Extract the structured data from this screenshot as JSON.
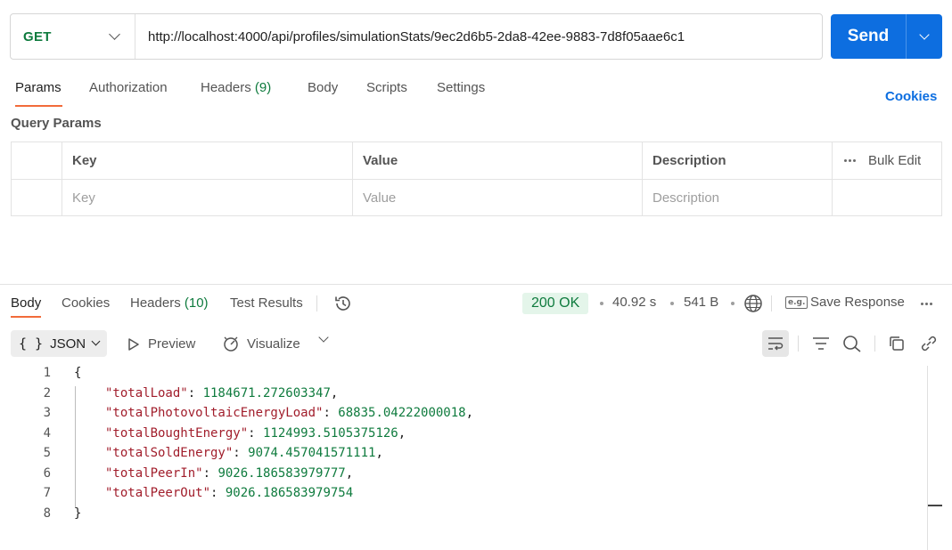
{
  "request": {
    "method": "GET",
    "url": "http://localhost:4000/api/profiles/simulationStats/9ec2d6b5-2da8-42ee-9883-7d8f05aae6c1",
    "send_label": "Send"
  },
  "request_tabs": {
    "params": "Params",
    "authorization": "Authorization",
    "headers": "Headers",
    "headers_count": "(9)",
    "body": "Body",
    "scripts": "Scripts",
    "settings": "Settings",
    "cookies": "Cookies"
  },
  "query_params": {
    "title": "Query Params",
    "columns": [
      "Key",
      "Value",
      "Description"
    ],
    "bulk_edit": "Bulk Edit",
    "placeholders": {
      "key": "Key",
      "value": "Value",
      "description": "Description"
    }
  },
  "response_tabs": {
    "body": "Body",
    "cookies": "Cookies",
    "headers": "Headers",
    "headers_count": "(10)",
    "test_results": "Test Results"
  },
  "response_meta": {
    "status": "200 OK",
    "time": "40.92 s",
    "size": "541 B",
    "example_badge": "e.g.",
    "save_response": "Save Response",
    "status_color": "#0f7b3e"
  },
  "response_toolbar": {
    "format_brace": "{ }",
    "format": "JSON",
    "preview": "Preview",
    "visualize": "Visualize"
  },
  "response_body": {
    "lines": [
      {
        "n": "1",
        "open": "{"
      },
      {
        "n": "2",
        "key": "\"totalLoad\"",
        "value": "1184671.272603347",
        "comma": ","
      },
      {
        "n": "3",
        "key": "\"totalPhotovoltaicEnergyLoad\"",
        "value": "68835.04222000018",
        "comma": ","
      },
      {
        "n": "4",
        "key": "\"totalBoughtEnergy\"",
        "value": "1124993.5105375126",
        "comma": ","
      },
      {
        "n": "5",
        "key": "\"totalSoldEnergy\"",
        "value": "9074.457041571111",
        "comma": ","
      },
      {
        "n": "6",
        "key": "\"totalPeerIn\"",
        "value": "9026.186583979777",
        "comma": ","
      },
      {
        "n": "7",
        "key": "\"totalPeerOut\"",
        "value": "9026.186583979754",
        "comma": ""
      },
      {
        "n": "8",
        "open": "}"
      }
    ]
  },
  "colors": {
    "accent": "#0d6ee0",
    "active_tab_underline": "#f26b3a",
    "method_get": "#0f7b3e",
    "json_key": "#a11d2b",
    "json_number": "#0f7b3e"
  },
  "icons": [
    "chevron-down-icon",
    "history-icon",
    "globe-icon",
    "more-icon",
    "play-icon",
    "visualize-icon",
    "wrap-lines-icon",
    "filter-icon",
    "search-icon",
    "copy-icon",
    "link-icon"
  ]
}
